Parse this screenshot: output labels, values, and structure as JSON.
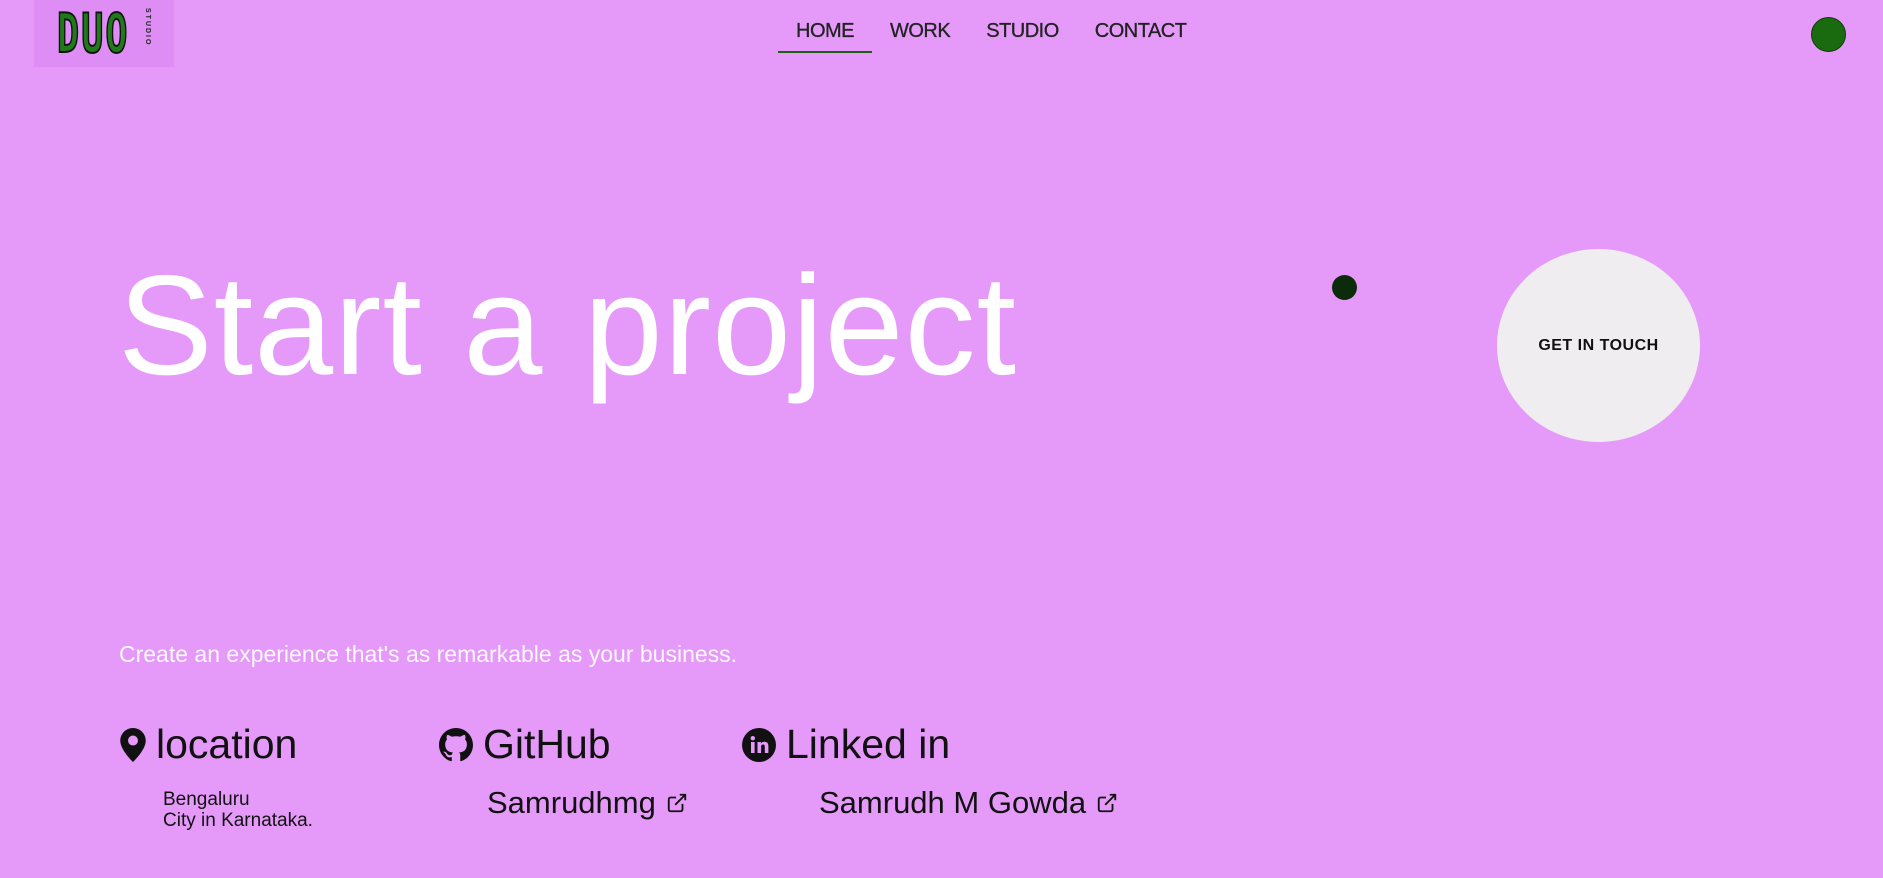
{
  "header": {
    "logo": {
      "text": "DUO",
      "sub": "STUDIO"
    },
    "nav": [
      {
        "label": "HOME",
        "active": true
      },
      {
        "label": "WORK",
        "active": false
      },
      {
        "label": "STUDIO",
        "active": false
      },
      {
        "label": "CONTACT",
        "active": false
      }
    ]
  },
  "hero": {
    "title": "Start a project",
    "cta": "GET IN TOUCH",
    "tagline": "Create an experience that's as remarkable as your business."
  },
  "contacts": {
    "location": {
      "heading": "location",
      "line1": "Bengaluru",
      "line2": "City in Karnataka."
    },
    "github": {
      "heading": "GitHub",
      "link": "Samrudhmg"
    },
    "linkedin": {
      "heading": "Linked in",
      "link": "Samrudh M Gowda"
    }
  },
  "colors": {
    "background": "#e59afa",
    "accent_green": "#1a6b10",
    "button_bg": "#efedef"
  },
  "icons": [
    "location-pin-icon",
    "github-icon",
    "linkedin-icon",
    "external-link-icon"
  ]
}
